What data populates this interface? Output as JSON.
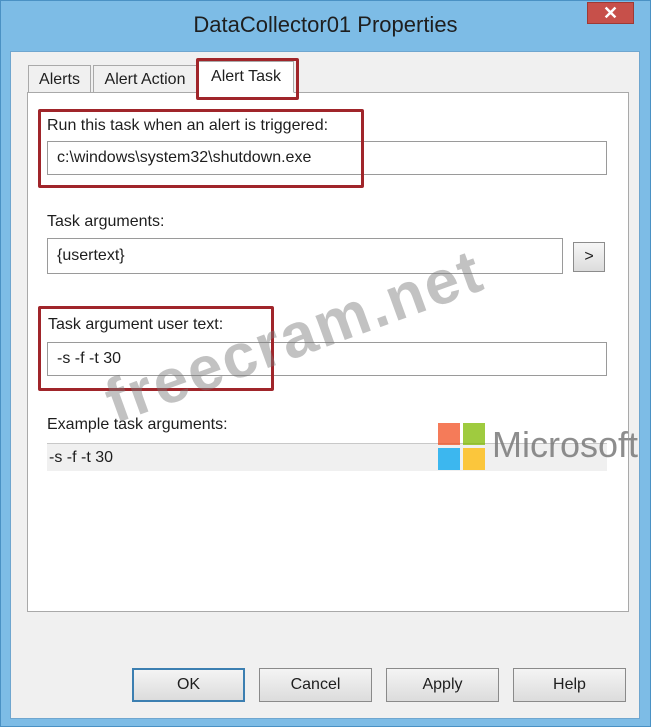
{
  "window": {
    "title": "DataCollector01 Properties",
    "close_glyph": "✕"
  },
  "tabs": [
    {
      "label": "Alerts",
      "active": false
    },
    {
      "label": "Alert Action",
      "active": false
    },
    {
      "label": "Alert Task",
      "active": true
    }
  ],
  "form": {
    "run_task_label": "Run this task when an alert is triggered:",
    "run_task_value": "c:\\windows\\system32\\shutdown.exe",
    "task_args_label": "Task arguments:",
    "task_args_value": "{usertext}",
    "task_args_button": ">",
    "user_text_label": "Task argument user text:",
    "user_text_value": "-s -f -t 30",
    "example_label": "Example task arguments:",
    "example_value": "-s -f -t 30"
  },
  "buttons": {
    "ok": "OK",
    "cancel": "Cancel",
    "apply": "Apply",
    "help": "Help"
  },
  "overlay": {
    "watermark": "freecram.net",
    "brand_text": "Microsoft",
    "brand_colors": [
      "#f25022",
      "#7fba00",
      "#00a4ef",
      "#ffb900"
    ]
  },
  "colors": {
    "highlight": "#a0252a",
    "titlebar": "#7dbce6",
    "close": "#c7504a"
  }
}
